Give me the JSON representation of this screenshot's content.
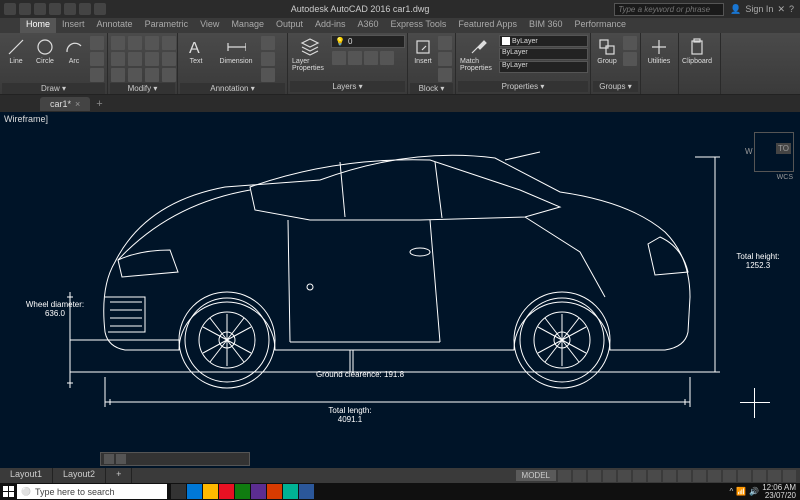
{
  "title": "Autodesk AutoCAD 2016   car1.dwg",
  "search_placeholder": "Type a keyword or phrase",
  "signin": "Sign In",
  "menus": [
    "Home",
    "Insert",
    "Annotate",
    "Parametric",
    "View",
    "Manage",
    "Output",
    "Add-ins",
    "A360",
    "Express Tools",
    "Featured Apps",
    "BIM 360",
    "Performance"
  ],
  "active_menu": 0,
  "ribbon": {
    "draw": {
      "title": "Draw ▾",
      "items": [
        "Line",
        "Circle",
        "Arc"
      ]
    },
    "modify": {
      "title": "Modify ▾"
    },
    "annotation": {
      "title": "Annotation ▾",
      "items": [
        "Text",
        "Dimension"
      ]
    },
    "layers": {
      "title": "Layers ▾",
      "item": "Layer Properties",
      "combo": "0"
    },
    "block": {
      "title": "Block ▾",
      "item": "Insert"
    },
    "properties": {
      "title": "Properties ▾",
      "item": "Match Properties",
      "combos": [
        "ByLayer",
        "ByLayer",
        "ByLayer"
      ]
    },
    "groups": {
      "title": "Groups ▾",
      "item": "Group"
    },
    "utilities": {
      "title": "",
      "item": "Utilities"
    },
    "clipboard": {
      "title": "",
      "item": "Clipboard"
    }
  },
  "tab": "car1*",
  "viewport_label": "Wireframe]",
  "dimensions": {
    "wheel": {
      "label": "Wheel diameter:",
      "value": "636.0"
    },
    "ground": {
      "label": "Ground clearence:",
      "value": "191.8"
    },
    "length": {
      "label": "Total length:",
      "value": "4091.1"
    },
    "height": {
      "label": "Total height:",
      "value": "1252.3"
    }
  },
  "navcube": {
    "w": "W",
    "top": "TO",
    "wcs": "WCS"
  },
  "layouts": [
    "Layout1",
    "Layout2",
    "+"
  ],
  "status_model": "MODEL",
  "taskbar_search": "Type here to search",
  "clock": {
    "time": "12:06 AM",
    "date": "23/07/20"
  }
}
